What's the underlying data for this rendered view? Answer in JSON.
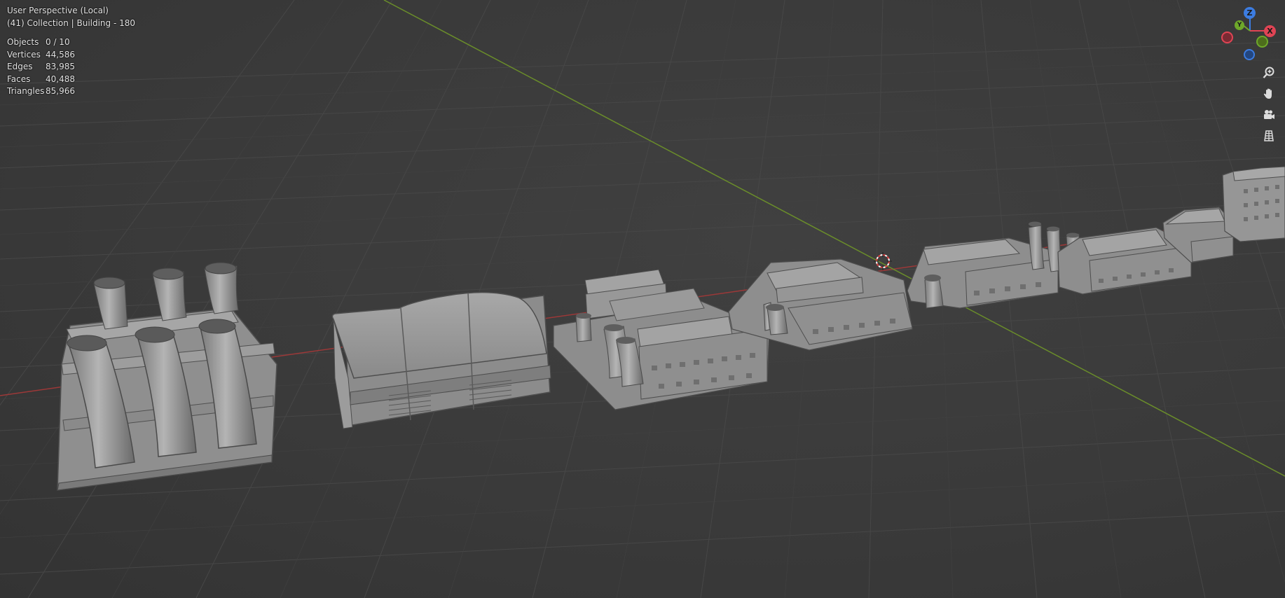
{
  "header": {
    "view_mode": "User Perspective (Local)",
    "collection": "(41) Collection | Building - 180"
  },
  "stats": [
    {
      "label": "Objects",
      "value": "0 / 10"
    },
    {
      "label": "Vertices",
      "value": "44,586"
    },
    {
      "label": "Edges",
      "value": "83,985"
    },
    {
      "label": "Faces",
      "value": "40,488"
    },
    {
      "label": "Triangles",
      "value": "85,966"
    }
  ],
  "gizmo": {
    "z_label": "Z",
    "y_label": "Y",
    "x_label": "X",
    "colors": {
      "x": "#e04454",
      "y": "#6ea82a",
      "z": "#3c7ce0"
    }
  },
  "toolbar": {
    "icons": [
      "zoom-icon",
      "hand-pan-icon",
      "camera-icon",
      "grid-ortho-icon"
    ]
  },
  "colors": {
    "background": "#3a3a3a",
    "grid": "#4a4a4a",
    "x_axis": "#a33a3a",
    "y_axis": "#6c8f2a",
    "model_fill": "#9a9a9a"
  }
}
